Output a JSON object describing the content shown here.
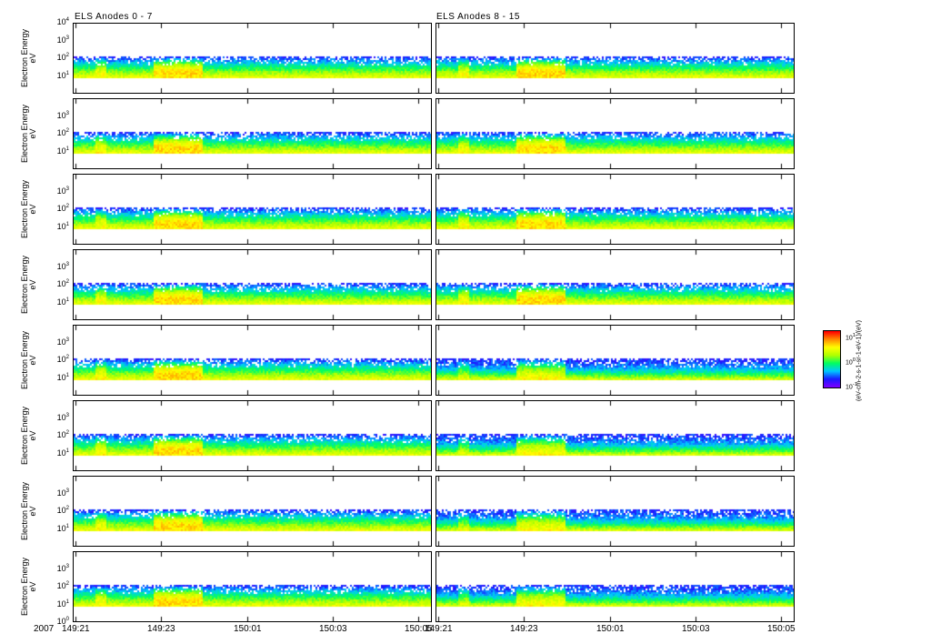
{
  "chart_data": {
    "type": "heatmap",
    "year_label": "2007",
    "ylabel": "Electron Energy",
    "yunit": "eV",
    "ylim_log10": [
      0,
      4
    ],
    "y_tick_exponents": [
      0,
      1,
      2,
      3,
      4
    ],
    "data_energy_range_eV": [
      10,
      150
    ],
    "columns": [
      {
        "title": "ELS Anodes 0 - 7",
        "x_ticks": [
          "149:21",
          "149:23",
          "150:01",
          "150:03",
          "150:05"
        ]
      },
      {
        "title": "ELS Anodes 8 - 15",
        "x_ticks": [
          "149:21",
          "149:23",
          "150:01",
          "150:03",
          "150:05"
        ]
      }
    ],
    "rows": 8,
    "colorbar": {
      "label": "(eV-cm-2-s-1-sr-1-eV-1)/(eV)",
      "tick_exponents": [
        "-1",
        "0",
        "1"
      ],
      "colormap": [
        "#7a00ff",
        "#1a1aff",
        "#00c8ff",
        "#00ff60",
        "#b0ff00",
        "#ffff00",
        "#ff8c00",
        "#ff0000"
      ]
    }
  }
}
